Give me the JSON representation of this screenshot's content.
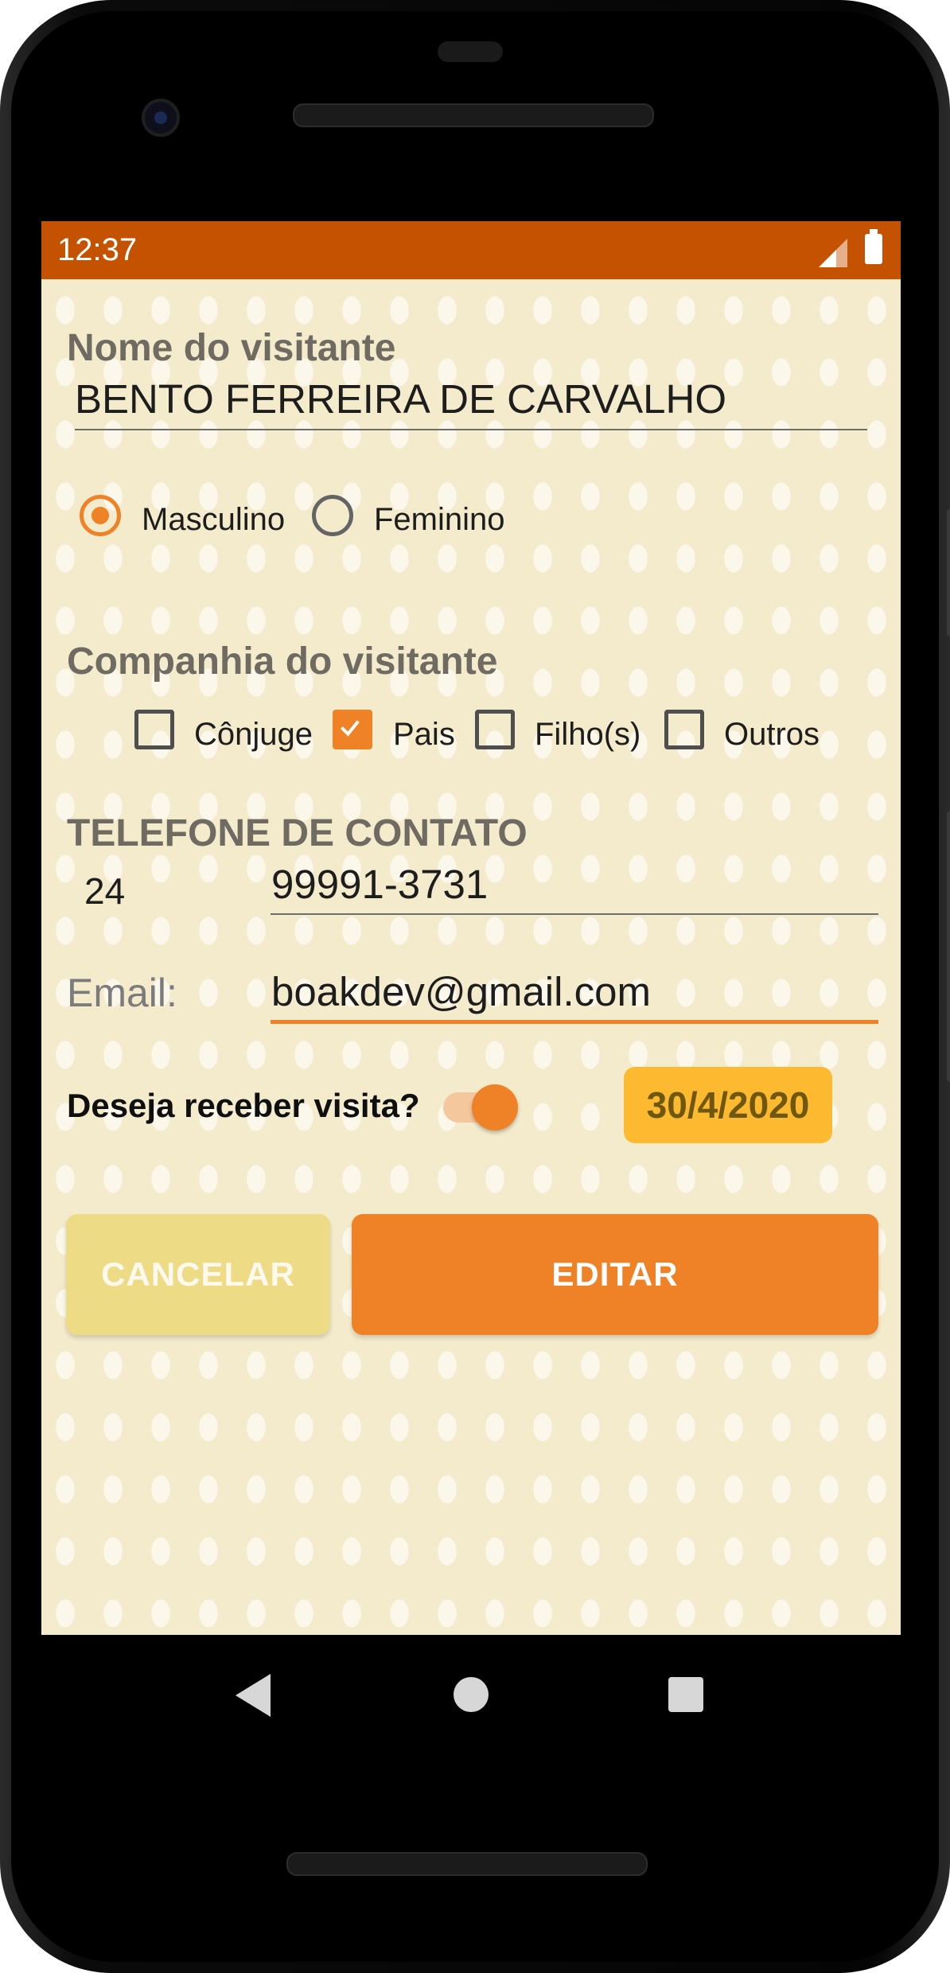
{
  "status_bar": {
    "time": "12:37"
  },
  "form": {
    "name_label": "Nome do visitante",
    "name_value": "BENTO FERREIRA DE CARVALHO",
    "gender": {
      "options": [
        {
          "label": "Masculino",
          "selected": true
        },
        {
          "label": "Feminino",
          "selected": false
        }
      ]
    },
    "companion_label": "Companhia do visitante",
    "companions": [
      {
        "label": "Cônjuge",
        "checked": false
      },
      {
        "label": "Pais",
        "checked": true
      },
      {
        "label": "Filho(s)",
        "checked": false
      },
      {
        "label": "Outros",
        "checked": false
      }
    ],
    "phone_label": "TELEFONE DE CONTATO",
    "phone_ddd": "24",
    "phone_number": "99991-3731",
    "email_label": "Email:",
    "email_value": "boakdev@gmail.com",
    "visit_label": "Deseja receber visita?",
    "visit_enabled": true,
    "date": "30/4/2020",
    "cancel_label": "CANCELAR",
    "edit_label": "EDITAR"
  },
  "colors": {
    "accent": "#ef8126",
    "status_bar": "#c45200",
    "background": "#f4ebcd",
    "date_button": "#fdb92f",
    "cancel_button": "#eddb86"
  },
  "icons": {
    "back": "back-triangle-icon",
    "home": "home-circle-icon",
    "recents": "recents-square-icon",
    "signal": "signal-icon",
    "battery": "battery-icon",
    "checkmark": "checkmark-icon"
  }
}
